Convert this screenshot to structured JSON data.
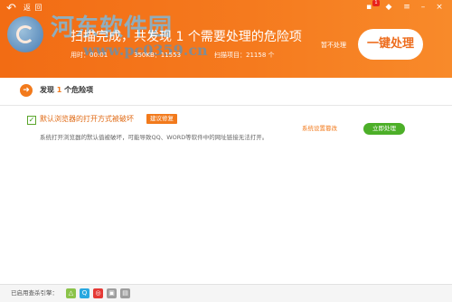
{
  "header": {
    "back_label": "返 回",
    "watermark": "河东软件园",
    "watermark_url": "www.pc0359.cn",
    "scan_title_prefix": "扫描完成，共发现",
    "scan_count": "1",
    "scan_title_suffix": "个需要处理的危险项",
    "meta_time": "用时：00:01",
    "meta_kb": "350KB：11553",
    "meta_items": "扫描项目：21158 个",
    "ignore_label": "暂不处理",
    "fix_all_label": "一键处理",
    "notify_badge": "1"
  },
  "summary": {
    "prefix": "发现",
    "count": "1",
    "suffix": "个危险项"
  },
  "items": [
    {
      "title": "默认浏览器的打开方式被破坏",
      "tag": "建议修复",
      "description": "系统打开浏览器的默认值被破坏，可能导致QQ、WORD等软件中的网址链接无法打开。",
      "category": "系统设置篡改",
      "action": "立即处理"
    }
  ],
  "footer": {
    "label": "已启用查杀引擎：",
    "engines": [
      {
        "name": "cloud-engine",
        "color": "#8bc34a",
        "glyph": "△"
      },
      {
        "name": "qvm-engine",
        "color": "#29a8e0",
        "glyph": "Q"
      },
      {
        "name": "avira-engine",
        "color": "#e53935",
        "glyph": "◎"
      },
      {
        "name": "system-repair-engine",
        "color": "#9e9e9e",
        "glyph": "▣"
      },
      {
        "name": "qex-engine",
        "color": "#9e9e9e",
        "glyph": "▤"
      }
    ]
  },
  "colors": {
    "accent": "#f27a1c",
    "header": "#f26c14",
    "fix_button": "#4caf28"
  }
}
